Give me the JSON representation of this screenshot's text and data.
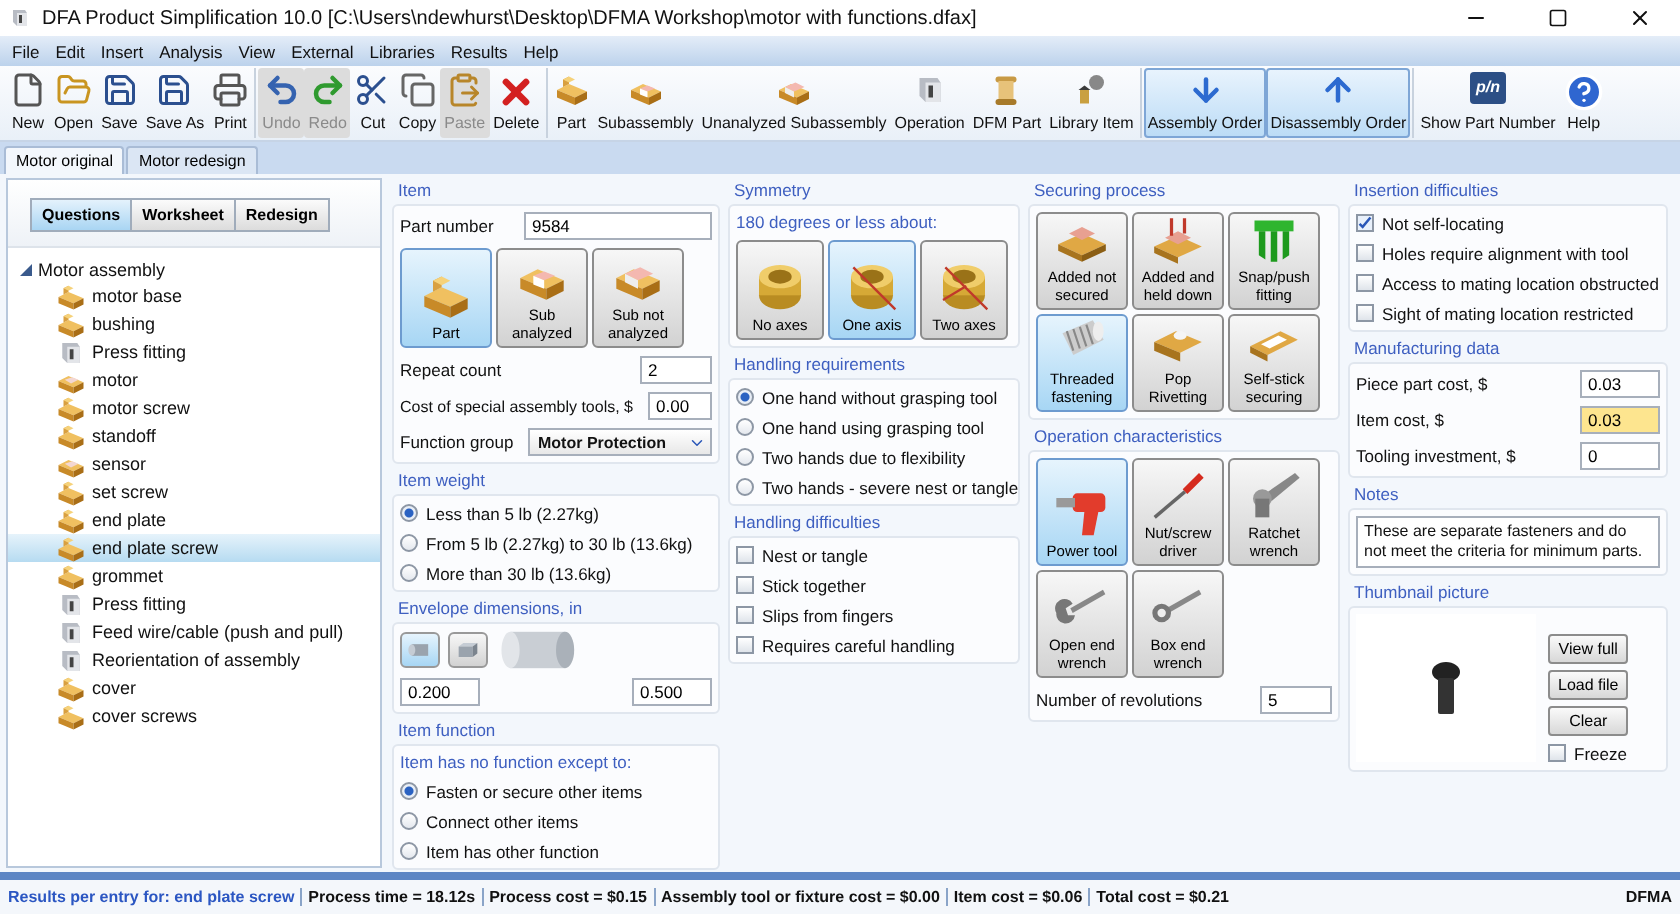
{
  "window": {
    "title": "DFA Product Simplification 10.0 [C:\\Users\\ndewhurst\\Desktop\\DFMA Workshop\\motor with functions.dfax]"
  },
  "menu": [
    "File",
    "Edit",
    "Insert",
    "Analysis",
    "View",
    "External",
    "Libraries",
    "Results",
    "Help"
  ],
  "toolbar": [
    [
      {
        "label": "New",
        "disabled": false,
        "selected": false
      },
      {
        "label": "Open",
        "disabled": false,
        "selected": false
      },
      {
        "label": "Save",
        "disabled": false,
        "selected": false
      },
      {
        "label": "Save As",
        "disabled": false,
        "selected": false
      },
      {
        "label": "Print",
        "disabled": false,
        "selected": false
      }
    ],
    [
      {
        "label": "Undo",
        "disabled": true,
        "selected": false
      },
      {
        "label": "Redo",
        "disabled": true,
        "selected": false
      },
      {
        "label": "Cut",
        "disabled": false,
        "selected": false
      },
      {
        "label": "Copy",
        "disabled": false,
        "selected": false
      },
      {
        "label": "Paste",
        "disabled": true,
        "selected": false
      },
      {
        "label": "Delete",
        "disabled": false,
        "selected": false
      }
    ],
    [
      {
        "label": "Part",
        "disabled": false,
        "selected": false
      },
      {
        "label": "Subassembly",
        "disabled": false,
        "selected": false
      },
      {
        "label": "Unanalyzed Subassembly",
        "disabled": false,
        "selected": false
      },
      {
        "label": "Operation",
        "disabled": false,
        "selected": false
      },
      {
        "label": "DFM Part",
        "disabled": false,
        "selected": false
      },
      {
        "label": "Library Item",
        "disabled": false,
        "selected": false
      }
    ],
    [
      {
        "label": "Assembly Order",
        "disabled": false,
        "selected": true
      },
      {
        "label": "Disassembly Order",
        "disabled": false,
        "selected": true
      }
    ],
    [
      {
        "label": "Show Part Number",
        "icon_text": "p/n",
        "disabled": false,
        "selected": false
      },
      {
        "label": "Help",
        "disabled": false,
        "selected": false
      }
    ]
  ],
  "doc_tabs": [
    {
      "label": "Motor original",
      "selected": true
    },
    {
      "label": "Motor redesign",
      "selected": false
    }
  ],
  "view_tabs": [
    {
      "label": "Questions",
      "selected": true
    },
    {
      "label": "Worksheet",
      "selected": false
    },
    {
      "label": "Redesign",
      "selected": false
    }
  ],
  "tree": {
    "label": "Motor assembly",
    "expanded": true,
    "children": [
      {
        "label": "motor base",
        "kind": "part",
        "selected": false
      },
      {
        "label": "bushing",
        "kind": "part",
        "selected": false
      },
      {
        "label": "Press fitting",
        "kind": "operation",
        "selected": false
      },
      {
        "label": "motor",
        "kind": "subassembly",
        "selected": false
      },
      {
        "label": "motor screw",
        "kind": "part",
        "selected": false
      },
      {
        "label": "standoff",
        "kind": "part",
        "selected": false
      },
      {
        "label": "sensor",
        "kind": "subassembly",
        "selected": false
      },
      {
        "label": "set screw",
        "kind": "part",
        "selected": false
      },
      {
        "label": "end plate",
        "kind": "part",
        "selected": false
      },
      {
        "label": "end plate screw",
        "kind": "part",
        "selected": true
      },
      {
        "label": "grommet",
        "kind": "part",
        "selected": false
      },
      {
        "label": "Press fitting",
        "kind": "operation",
        "selected": false
      },
      {
        "label": "Feed wire/cable (push and pull)",
        "kind": "operation",
        "selected": false
      },
      {
        "label": "Reorientation of assembly",
        "kind": "operation",
        "selected": false
      },
      {
        "label": "cover",
        "kind": "part",
        "selected": false
      },
      {
        "label": "cover screws",
        "kind": "part",
        "selected": false
      }
    ]
  },
  "item": {
    "title": "Item",
    "part_number_label": "Part number",
    "part_number": "9584",
    "types": [
      {
        "label": "Part",
        "selected": true
      },
      {
        "label": "Sub analyzed",
        "selected": false
      },
      {
        "label": "Sub not analyzed",
        "selected": false
      }
    ],
    "repeat_label": "Repeat count",
    "repeat": "2",
    "tools_label": "Cost of special assembly tools, $",
    "tools": "0.00",
    "function_label": "Function group",
    "function": "Motor Protection"
  },
  "item_weight": {
    "title": "Item weight",
    "options": [
      {
        "label": "Less than 5 lb (2.27kg)",
        "selected": true
      },
      {
        "label": "From 5 lb (2.27kg) to 30 lb (13.6kg)",
        "selected": false
      },
      {
        "label": "More than 30 lb (13.6kg)",
        "selected": false
      }
    ]
  },
  "envelope": {
    "title": "Envelope dimensions, in",
    "shapes": [
      {
        "selected": true
      },
      {
        "selected": false
      }
    ],
    "dimension_1": "0.200",
    "dimension_2": "0.500"
  },
  "item_function": {
    "title": "Item function",
    "prompt": "Item has no function except to:",
    "options": [
      {
        "label": "Fasten or secure other items",
        "selected": true
      },
      {
        "label": "Connect other items",
        "selected": false
      },
      {
        "label": "Item has other function",
        "selected": false
      }
    ]
  },
  "symmetry": {
    "title": "Symmetry",
    "prompt": "180 degrees or less about:",
    "options": [
      {
        "label": "No axes",
        "selected": false
      },
      {
        "label": "One axis",
        "selected": true
      },
      {
        "label": "Two axes",
        "selected": false
      }
    ]
  },
  "handling_requirements": {
    "title": "Handling requirements",
    "options": [
      {
        "label": "One hand without grasping tool",
        "selected": true
      },
      {
        "label": "One hand using grasping tool",
        "selected": false
      },
      {
        "label": "Two hands due to flexibility",
        "selected": false
      },
      {
        "label": "Two hands - severe nest or tangle",
        "selected": false
      }
    ]
  },
  "handling_difficulties": {
    "title": "Handling difficulties",
    "items": [
      {
        "label": "Nest or tangle",
        "checked": false
      },
      {
        "label": "Stick together",
        "checked": false
      },
      {
        "label": "Slips from fingers",
        "checked": false
      },
      {
        "label": "Requires careful handling",
        "checked": false
      }
    ]
  },
  "securing": {
    "title": "Securing process",
    "options": [
      {
        "label": "Added not secured",
        "selected": false
      },
      {
        "label": "Added and held down",
        "selected": false
      },
      {
        "label": "Snap/push fitting",
        "selected": false
      },
      {
        "label": "Threaded fastening",
        "selected": true
      },
      {
        "label": "Pop Rivetting",
        "selected": false
      },
      {
        "label": "Self-stick securing",
        "selected": false
      }
    ]
  },
  "operation": {
    "title": "Operation characteristics",
    "options": [
      {
        "label": "Power tool",
        "selected": true
      },
      {
        "label": "Nut/screw driver",
        "selected": false
      },
      {
        "label": "Ratchet wrench",
        "selected": false
      },
      {
        "label": "Open end wrench",
        "selected": false
      },
      {
        "label": "Box end wrench",
        "selected": false
      }
    ],
    "revolutions_label": "Number of revolutions",
    "revolutions": "5"
  },
  "insertion": {
    "title": "Insertion difficulties",
    "items": [
      {
        "label": "Not self-locating",
        "checked": true
      },
      {
        "label": "Holes require alignment with tool",
        "checked": false
      },
      {
        "label": "Access to mating location obstructed",
        "checked": false
      },
      {
        "label": "Sight of mating location restricted",
        "checked": false
      }
    ]
  },
  "manufacturing": {
    "title": "Manufacturing data",
    "rows": [
      {
        "label": "Piece part cost, $",
        "value": "0.03",
        "highlighted": false
      },
      {
        "label": "Item cost, $",
        "value": "0.03",
        "highlighted": true
      },
      {
        "label": "Tooling investment, $",
        "value": "0",
        "highlighted": false
      }
    ]
  },
  "notes": {
    "title": "Notes",
    "text": "These are separate fasteners and do not meet the criteria for minimum parts."
  },
  "thumbnail": {
    "title": "Thumbnail picture",
    "buttons": [
      "View full",
      "Load file",
      "Clear"
    ],
    "freeze": {
      "label": "Freeze",
      "checked": false
    }
  },
  "status_bar": {
    "label": "Results per entry for:",
    "entry": "end plate screw",
    "items": [
      "Process time = 18.12s",
      "Process cost = $0.15",
      "Assembly tool or fixture cost = $0.00",
      "Item cost = $0.06",
      "Total cost = $0.21"
    ],
    "brand": "DFMA"
  }
}
